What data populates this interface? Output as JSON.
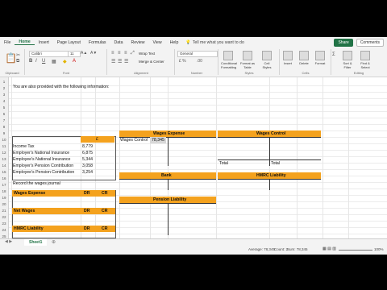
{
  "ribbon_tabs": [
    "File",
    "Home",
    "Insert",
    "Page Layout",
    "Formulas",
    "Data",
    "Review",
    "View",
    "Help"
  ],
  "active_tab": "Home",
  "tell_me": "Tell me what you want to do",
  "share": "Share",
  "comments": "Comments",
  "ribbon": {
    "clipboard": "Clipboard",
    "font_name": "Calibri",
    "font_size": "11",
    "font_group": "Font",
    "wrap_text": "Wrap Text",
    "merge_center": "Merge & Center",
    "alignment": "Alignment",
    "number_format": "General",
    "number": "Number",
    "conditional": "Conditional Formatting",
    "format_table": "Format as Table",
    "cell_styles": "Cell Styles",
    "styles": "Styles",
    "insert": "Insert",
    "delete": "Delete",
    "format": "Format",
    "cells": "Cells",
    "sort_filter": "Sort & Filter",
    "find_select": "Find & Select",
    "editing": "Editing"
  },
  "intro_line": "You are also provided with the following information:",
  "info_header": "£",
  "info_rows": [
    {
      "label": "Income Tax",
      "value": "8,779"
    },
    {
      "label": "Employer's National Insurance",
      "value": "6,875"
    },
    {
      "label": "Employee's National Insurance",
      "value": "5,344"
    },
    {
      "label": "Employer's Pension Contribution",
      "value": "3,058"
    },
    {
      "label": "Employee's Pension Contribution",
      "value": "3,254"
    }
  ],
  "record_title": "Record the wages journal",
  "journal": [
    {
      "title": "Wages Expense",
      "dr": "DR",
      "cr": "CR"
    },
    {
      "title": "Net Wages",
      "dr": "DR",
      "cr": "CR"
    },
    {
      "title": "HMRC Liability",
      "dr": "DR",
      "cr": "CR"
    },
    {
      "title": "Pension Liability",
      "dr": "DR",
      "cr": "CR"
    }
  ],
  "t_accounts": {
    "wages_expense": "Wages Expense",
    "wages_control_entry": "Wages Control",
    "wages_control_value": "78,345",
    "wages_control": "Wages Control",
    "total": "Total",
    "bank": "Bank",
    "hmrc": "HMRC Liability",
    "pension": "Pension Liability"
  },
  "sheet_tab": "Sheet1",
  "status": {
    "average": "Average: 78,345",
    "count": "Count: 2",
    "sum": "Sum: 78,345",
    "zoom": "100%"
  },
  "colors": {
    "accent": "#217346",
    "header_orange": "#f4a21e"
  }
}
